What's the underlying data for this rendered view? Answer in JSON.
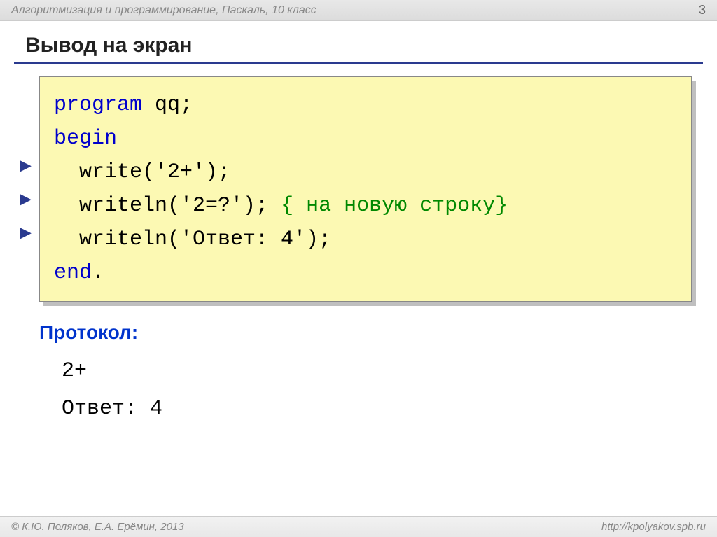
{
  "header": {
    "course": "Алгоритмизация и программирование, Паскаль, 10 класс",
    "page": "3"
  },
  "title": "Вывод на экран",
  "code": {
    "l1_kw": "program",
    "l1_rest": " qq;",
    "l2_kw": "begin",
    "l3a": "  write(",
    "l3s": "'2+'",
    "l3b": ");",
    "l4a": "  writeln(",
    "l4s": "'2=?'",
    "l4b": "); ",
    "l4c": "{ на новую строку}",
    "l5a": "  writeln(",
    "l5s": "'Ответ: 4'",
    "l5b": ");",
    "l6_kw": "end",
    "l6_rest": "."
  },
  "protocol_label": "Протокол:",
  "protocol": {
    "line1": "2+",
    "line2": "Ответ: 4"
  },
  "footer": {
    "copyright": "© К.Ю. Поляков, Е.А. Ерёмин, 2013",
    "url": "http://kpolyakov.spb.ru"
  }
}
